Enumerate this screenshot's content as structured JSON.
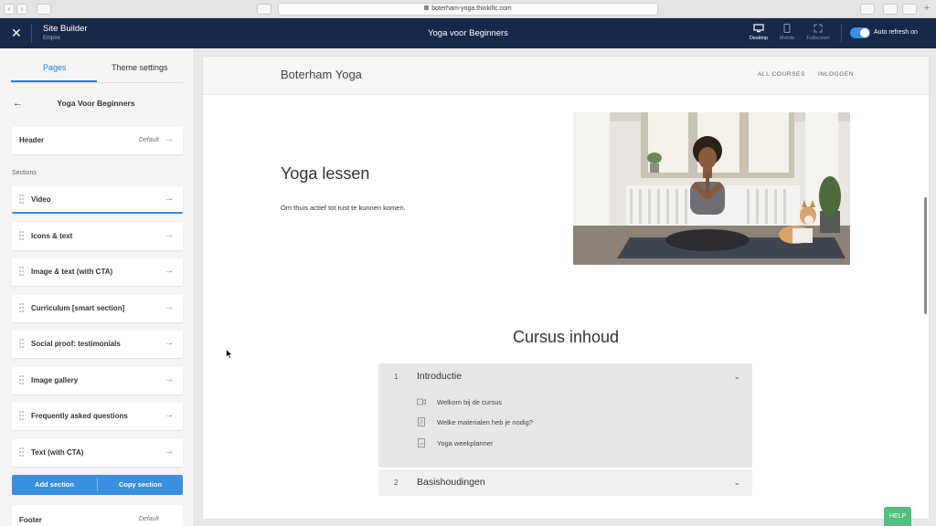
{
  "browser": {
    "url": "boterham-yoga.thinkific.com"
  },
  "topbar": {
    "close_icon": "close-icon",
    "app_title": "Site Builder",
    "app_subtitle": "Empire",
    "page_name": "Yoga voor Beginners",
    "devices": [
      {
        "label": "Desktop",
        "icon": "desktop-icon",
        "active": true
      },
      {
        "label": "Mobile",
        "icon": "mobile-icon",
        "active": false
      },
      {
        "label": "Fullscreen",
        "icon": "fullscreen-icon",
        "active": false
      }
    ],
    "auto_refresh_label": "Auto refresh on",
    "auto_refresh_on": true
  },
  "sidebar": {
    "tabs": [
      {
        "label": "Pages",
        "active": true
      },
      {
        "label": "Theme settings",
        "active": false
      }
    ],
    "page_title": "Yoga Voor Beginners",
    "header_card": {
      "label": "Header",
      "value": "Default"
    },
    "sections_label": "Sections",
    "sections": [
      {
        "label": "Video",
        "selected": true
      },
      {
        "label": "Icons & text"
      },
      {
        "label": "Image & text (with CTA)"
      },
      {
        "label": "Curriculum [smart section]"
      },
      {
        "label": "Social proof: testimonials"
      },
      {
        "label": "Image gallery"
      },
      {
        "label": "Frequently asked questions"
      },
      {
        "label": "Text (with CTA)"
      }
    ],
    "add_section_label": "Add section",
    "copy_section_label": "Copy section",
    "footer_card": {
      "label": "Footer",
      "value": "Default"
    }
  },
  "preview": {
    "site_name": "Boterham Yoga",
    "nav": [
      "ALL COURSES",
      "INLOGGEN"
    ],
    "hero_title": "Yoga lessen",
    "hero_text": "Om thuis actief tot rust te kunnen komen.",
    "curriculum_title": "Cursus inhoud",
    "chapters": [
      {
        "number": "1",
        "title": "Introductie",
        "expanded": true,
        "lessons": [
          {
            "icon": "video-icon",
            "title": "Welkom bij de cursus"
          },
          {
            "icon": "document-icon",
            "title": "Welke materialen heb je nodig?"
          },
          {
            "icon": "download-icon",
            "title": "Yoga weekplanner"
          }
        ]
      },
      {
        "number": "2",
        "title": "Basishoudingen",
        "expanded": false,
        "lessons": []
      }
    ]
  },
  "help_label": "HELP",
  "colors": {
    "topbar": "#18284a",
    "accent": "#3a8fe0",
    "help": "#4fbf82"
  }
}
